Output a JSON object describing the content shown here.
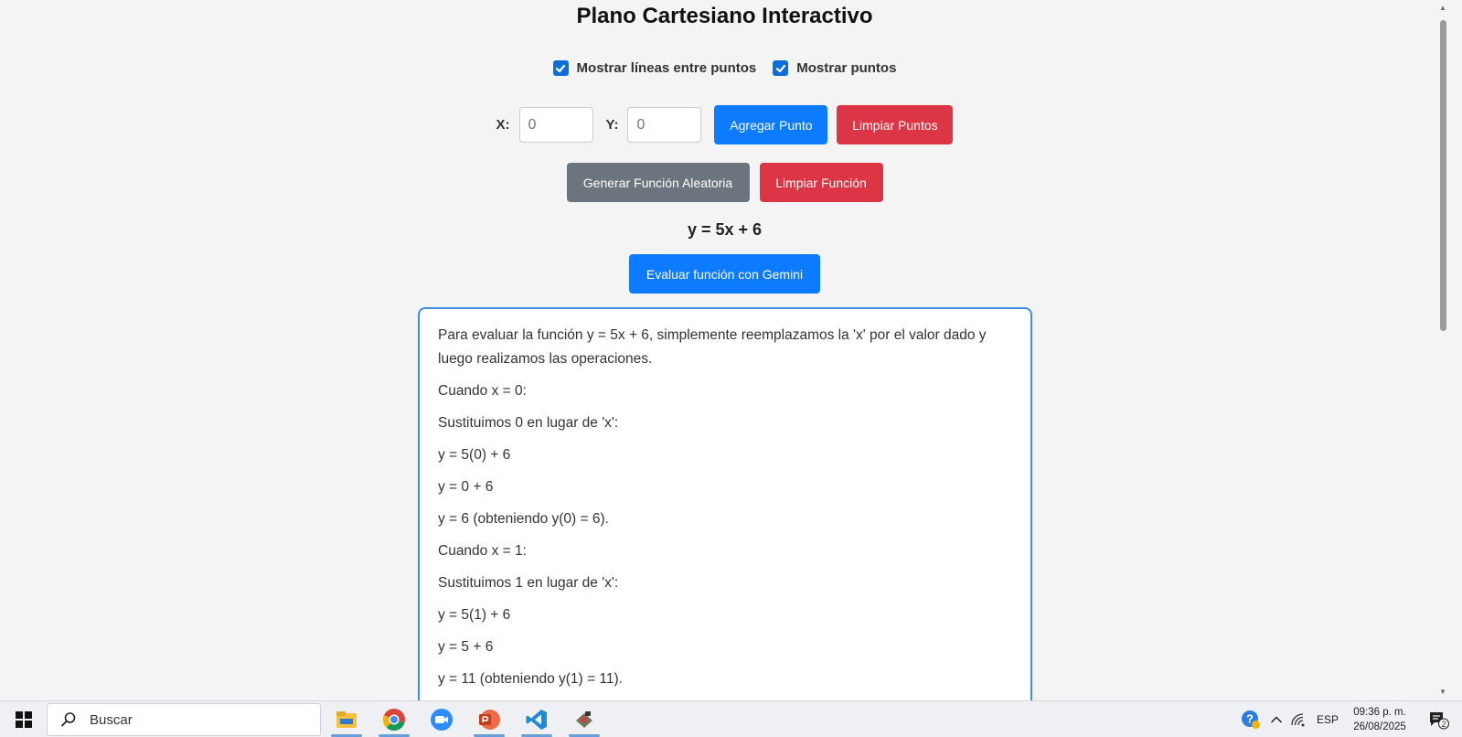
{
  "header": {
    "title": "Plano Cartesiano Interactivo"
  },
  "options": {
    "show_lines_label": "Mostrar líneas entre puntos",
    "show_lines_checked": true,
    "show_points_label": "Mostrar puntos",
    "show_points_checked": true
  },
  "point_input": {
    "x_label": "X:",
    "x_placeholder": "0",
    "y_label": "Y:",
    "y_placeholder": "0",
    "add_button": "Agregar Punto",
    "clear_button": "Limpiar Puntos"
  },
  "function_controls": {
    "generate_button": "Generar Función Aleatoria",
    "clear_button": "Limpiar Función",
    "formula": "y = 5x + 6",
    "evaluate_button": "Evaluar función con Gemini"
  },
  "result": {
    "paragraphs": [
      "Para evaluar la función y = 5x + 6, simplemente reemplazamos la 'x' por el valor dado y luego realizamos las operaciones.",
      "Cuando x = 0:",
      "Sustituimos 0 en lugar de 'x':",
      "y = 5(0) + 6",
      "y = 0 + 6",
      "y = 6 (obteniendo y(0) = 6).",
      "Cuando x = 1:",
      "Sustituimos 1 en lugar de 'x':",
      "y = 5(1) + 6",
      "y = 5 + 6",
      "y = 11 (obteniendo y(1) = 11)."
    ]
  },
  "taskbar": {
    "search_placeholder": "Buscar",
    "apps": [
      "file-explorer-icon",
      "chrome-icon",
      "zoom-icon",
      "powerpoint-icon",
      "vscode-icon",
      "app-icon"
    ],
    "language": "ESP",
    "time": "09:36 p. m.",
    "date": "26/08/2025",
    "notification_count": "2"
  },
  "colors": {
    "primary": "#0d7bff",
    "danger": "#dc3545",
    "secondary": "#6c757d",
    "result_border": "#3d8fe6"
  }
}
